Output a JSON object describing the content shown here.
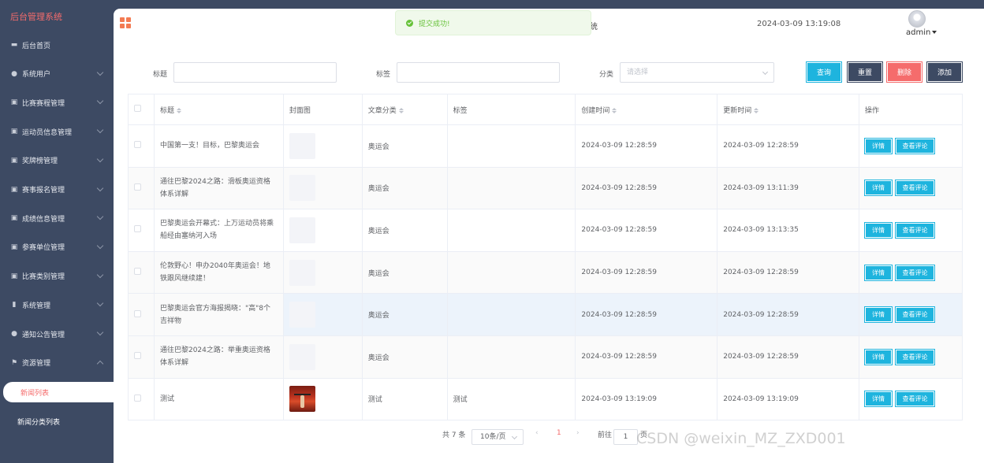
{
  "app": {
    "brand": "后台管理系统"
  },
  "sidebar": {
    "items": [
      {
        "label": "后台首页",
        "icon": "monitor-icon",
        "has_arrow": false
      },
      {
        "label": "系统用户",
        "icon": "user-icon",
        "has_arrow": true
      },
      {
        "label": "比赛赛程管理",
        "icon": "grid-square-icon",
        "has_arrow": true
      },
      {
        "label": "运动员信息管理",
        "icon": "grid-square-icon",
        "has_arrow": true
      },
      {
        "label": "奖牌榜管理",
        "icon": "grid-square-icon",
        "has_arrow": true
      },
      {
        "label": "赛事报名管理",
        "icon": "grid-square-icon",
        "has_arrow": true
      },
      {
        "label": "成绩信息管理",
        "icon": "grid-square-icon",
        "has_arrow": true
      },
      {
        "label": "参赛单位管理",
        "icon": "grid-square-icon",
        "has_arrow": true
      },
      {
        "label": "比赛类别管理",
        "icon": "grid-square-icon",
        "has_arrow": true
      },
      {
        "label": "系统管理",
        "icon": "bar-chart-icon",
        "has_arrow": true
      },
      {
        "label": "通知公告管理",
        "icon": "info-circle-icon",
        "has_arrow": true
      },
      {
        "label": "资源管理",
        "icon": "flag-icon",
        "has_arrow": true,
        "expanded": true
      }
    ],
    "subitems": [
      {
        "label": "新闻列表",
        "active": true
      },
      {
        "label": "新闻分类列表",
        "active": false
      }
    ]
  },
  "header": {
    "title_fragment": "统",
    "datetime": "2024-03-09 13:19:08",
    "user": "admin"
  },
  "toast": {
    "message": "提交成功!",
    "type": "success"
  },
  "filters": {
    "title_label": "标题",
    "tag_label": "标签",
    "category_label": "分类",
    "category_placeholder": "请选择"
  },
  "buttons": {
    "search": "查询",
    "reset": "重置",
    "delete": "删除",
    "add": "添加"
  },
  "colors": {
    "sidebar_bg": "#3d4a63",
    "search_btn": "#1eb4de",
    "reset_btn": "#3d4a63",
    "delete_btn": "#f56c6c",
    "add_btn": "#3d4a63",
    "brand": "#f56c6c"
  },
  "table": {
    "columns": [
      "标题",
      "封面图",
      "文章分类",
      "标签",
      "创建时间",
      "更新时间",
      "操作"
    ],
    "rows": [
      {
        "title": "中国第一支！目标，巴黎奥运会",
        "cover": "blank",
        "category": "奥运会",
        "tag": "",
        "created": "2024-03-09 12:28:59",
        "updated": "2024-03-09 12:28:59"
      },
      {
        "title": "通往巴黎2024之路：滑板奥运资格体系详解",
        "cover": "blank",
        "category": "奥运会",
        "tag": "",
        "created": "2024-03-09 12:28:59",
        "updated": "2024-03-09 13:11:39"
      },
      {
        "title": "巴黎奥运会开幕式：上万运动员将乘船经由塞纳河入场",
        "cover": "blank",
        "category": "奥运会",
        "tag": "",
        "created": "2024-03-09 12:28:59",
        "updated": "2024-03-09 13:13:35"
      },
      {
        "title": "伦敦野心！申办2040年奥运会！地铁跟风继续建！",
        "cover": "blank",
        "category": "奥运会",
        "tag": "",
        "created": "2024-03-09 12:28:59",
        "updated": "2024-03-09 12:28:59"
      },
      {
        "title": "巴黎奥运会官方海报揭晓：\"高\"8个吉祥物",
        "cover": "blank",
        "category": "奥运会",
        "tag": "",
        "created": "2024-03-09 12:28:59",
        "updated": "2024-03-09 12:28:59"
      },
      {
        "title": "通往巴黎2024之路：举重奥运资格体系详解",
        "cover": "blank",
        "category": "奥运会",
        "tag": "",
        "created": "2024-03-09 12:28:59",
        "updated": "2024-03-09 12:28:59"
      },
      {
        "title": "测试",
        "cover": "photo",
        "category": "测试",
        "tag": "测试",
        "created": "2024-03-09 13:19:09",
        "updated": "2024-03-09 13:19:09"
      }
    ],
    "actions": {
      "detail": "详情",
      "comments": "查看评论"
    }
  },
  "pagination": {
    "total": "共 7 条",
    "page_size": "10条/页",
    "current": "1",
    "goto_label": "前往",
    "goto_value": "1",
    "page_suffix": "页"
  },
  "watermark": "CSDN @weixin_MZ_ZXD001"
}
